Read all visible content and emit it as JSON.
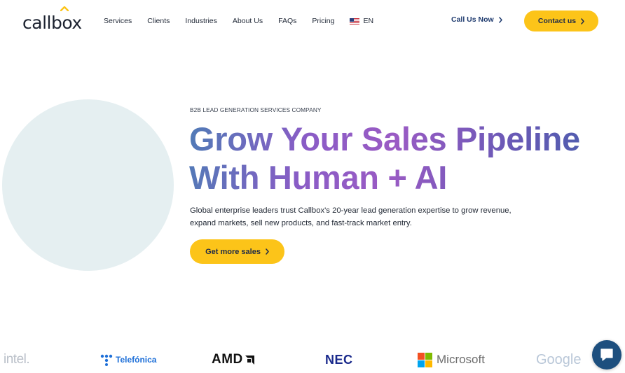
{
  "brand": {
    "name": "callbox",
    "accent": "#fcc419",
    "navy": "#1e3a6e"
  },
  "nav": {
    "items": [
      {
        "label": "Services"
      },
      {
        "label": "Clients"
      },
      {
        "label": "Industries"
      },
      {
        "label": "About Us"
      },
      {
        "label": "FAQs"
      },
      {
        "label": "Pricing"
      }
    ],
    "language": "EN",
    "language_icon": "us-flag-icon",
    "call_label": "Call Us Now",
    "contact_label": "Contact us"
  },
  "hero": {
    "eyebrow": "B2B LEAD GENERATION SERVICES COMPANY",
    "headline_line1": "Grow Your Sales Pipeline",
    "headline_line2": "With Human + AI",
    "subtext": "Global enterprise leaders trust Callbox's 20-year lead generation expertise to grow revenue, expand markets, sell new products, and fast-track market entry.",
    "cta_label": "Get more sales"
  },
  "client_logos": {
    "intel": "intel.",
    "telefonica": "Telefónica",
    "amd": "AMD",
    "nec": "NEC",
    "microsoft": "Microsoft",
    "google": "Google"
  },
  "chat": {
    "icon": "chat-bubble-icon"
  }
}
